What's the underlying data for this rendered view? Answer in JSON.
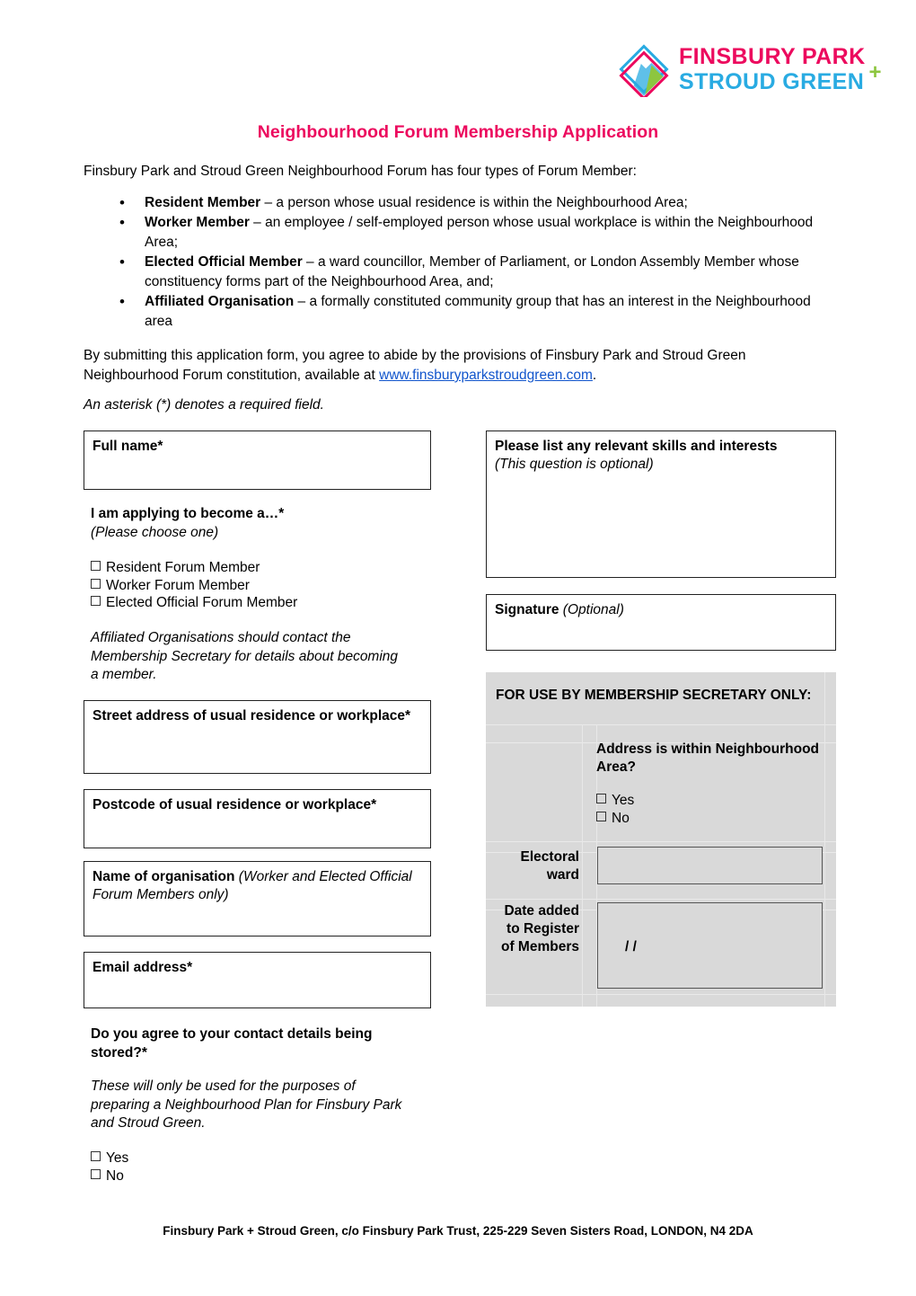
{
  "logo": {
    "line1": "FINSBURY PARK",
    "line2": "STROUD GREEN",
    "plus": "+",
    "colors": {
      "pink": "#ec0a5e",
      "cyan": "#29abe2",
      "green": "#8dc63f"
    }
  },
  "title": "Neighbourhood Forum Membership Application",
  "title_color": "#ec0a5e",
  "intro": "Finsbury Park and Stroud Green Neighbourhood Forum has four types of Forum Member:",
  "bullets": [
    {
      "term": "Resident Member",
      "rest": " – a person whose usual residence is within the Neighbourhood Area;"
    },
    {
      "term": "Worker Member",
      "rest": " – an employee / self-employed person whose usual workplace is within the Neighbourhood Area;"
    },
    {
      "term": "Elected Official Member",
      "rest": " – a ward councillor, Member of Parliament, or London Assembly Member whose constituency forms part of the Neighbourhood Area, and;"
    },
    {
      "term": "Affiliated Organisation",
      "rest": " – a formally constituted community group that has an interest in the Neighbourhood area"
    }
  ],
  "agreement": {
    "before": "By submitting this application form, you agree to abide by the provisions of Finsbury Park and Stroud Green Neighbourhood Forum constitution, available at ",
    "link": "www.finsburyparkstroudgreen.com",
    "link_color": "#1155cc",
    "after": "."
  },
  "asterisk_note": "An asterisk (*) denotes a required field.",
  "form": {
    "full_name_label": "Full name*",
    "applying_label": "I am applying to become a…*",
    "applying_sub": "(Please choose one)",
    "member_options": [
      "Resident Forum Member",
      "Worker Forum Member",
      "Elected Official Forum Member"
    ],
    "affiliated_note": "Affiliated Organisations should contact the Membership Secretary for details about becoming a member.",
    "street_label": "Street address of usual residence or workplace*",
    "postcode_label": "Postcode of usual residence or workplace*",
    "org_label_bold": "Name of organisation ",
    "org_label_italic": "(Worker and Elected Official Forum Members only)",
    "email_label": "Email address*",
    "consent_label": "Do you agree to your contact details being stored?*",
    "consent_note": "These will only be used for the purposes of preparing a Neighbourhood Plan for Finsbury Park and Stroud Green.",
    "consent_options": [
      "Yes",
      "No"
    ],
    "skills_label": "Please list any relevant skills and interests",
    "skills_sub": "(This question is optional)",
    "signature_label_bold": "Signature ",
    "signature_label_italic": "(Optional)"
  },
  "secretary": {
    "heading": "FOR USE BY MEMBERSHIP SECRETARY ONLY:",
    "question": "Address is within Neighbourhood Area?",
    "question_options": [
      "Yes",
      "No"
    ],
    "ward_label": "Electoral ward",
    "ward_value": "",
    "date_label": "Date added to Register of Members",
    "date_value": "/        /",
    "background": "#d9d9d9"
  },
  "footer": "Finsbury Park + Stroud Green, c/o Finsbury Park Trust, 225-229 Seven Sisters Road, LONDON, N4 2DA"
}
